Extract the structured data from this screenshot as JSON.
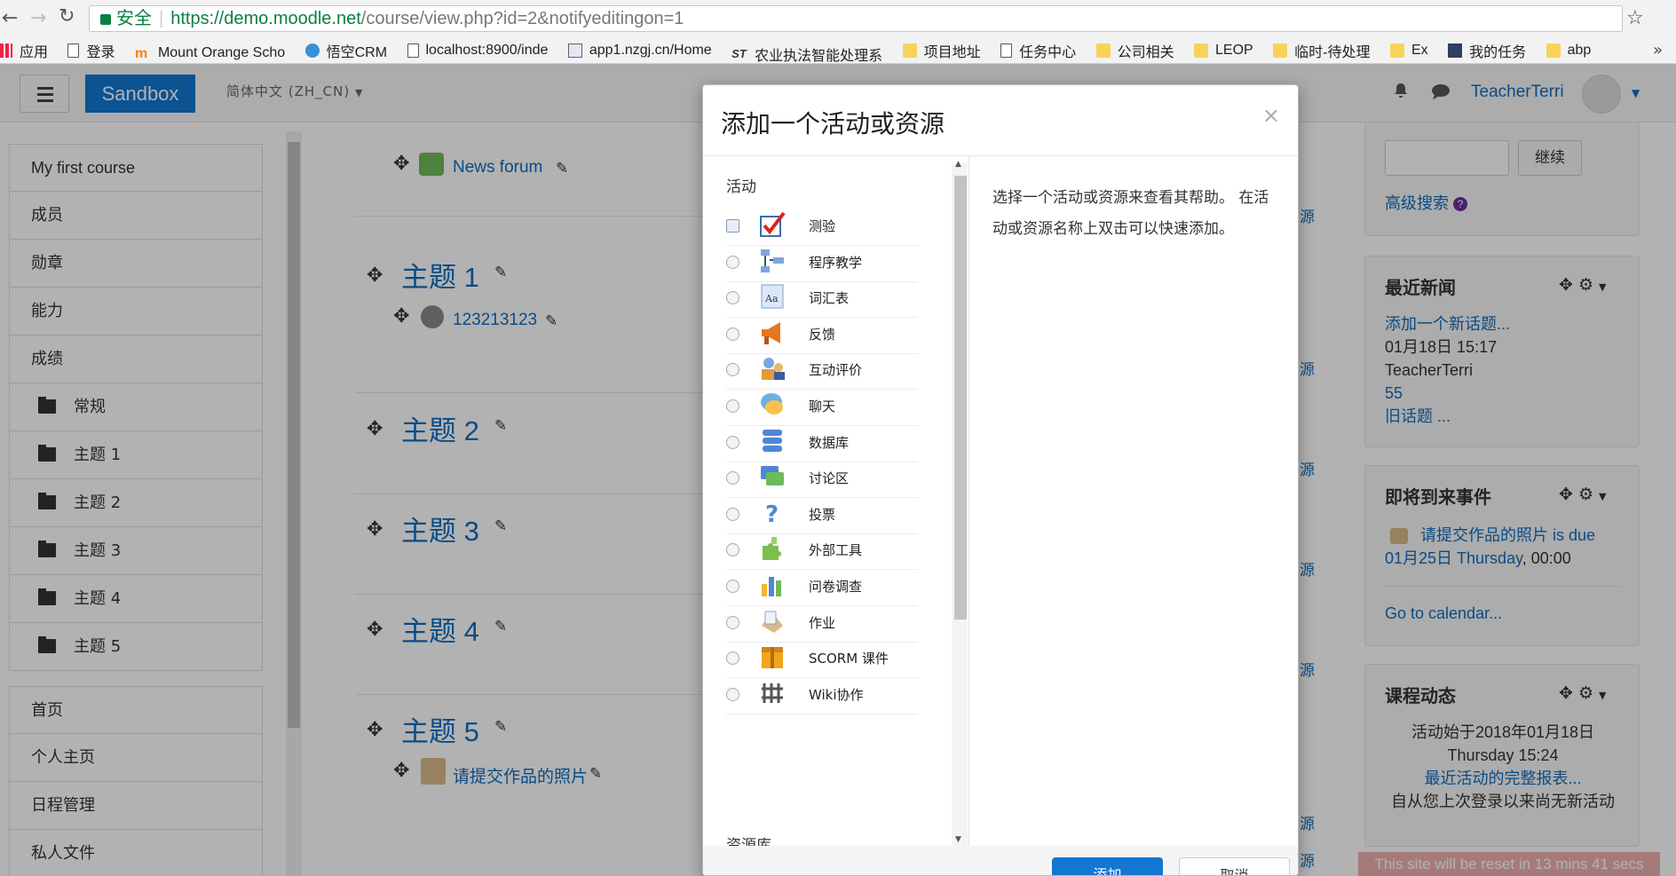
{
  "browser": {
    "secure_label": "安全",
    "url_host": "https://demo.moodle.net",
    "url_path": "/course/view.php?id=2&notifyeditingon=1",
    "bookmarks": [
      "应用",
      "登录",
      "Mount Orange Scho",
      "悟空CRM",
      "localhost:8900/inde",
      "app1.nzgj.cn/Home",
      "农业执法智能处理系",
      "项目地址",
      "任务中心",
      "公司相关",
      "LEOP",
      "临时-待处理",
      "Ex",
      "我的任务",
      "abp"
    ]
  },
  "navbar": {
    "brand": "Sandbox",
    "language": "简体中文 (ZH_CN)",
    "user": "TeacherTerri"
  },
  "leftnav": {
    "course_title": "My first course",
    "items": [
      "成员",
      "勋章",
      "能力",
      "成绩"
    ],
    "sections": [
      "常规",
      "主题 1",
      "主题 2",
      "主题 3",
      "主题 4",
      "主题 5"
    ],
    "global": [
      "首页",
      "个人主页",
      "日程管理",
      "私人文件"
    ]
  },
  "course": {
    "news_forum": "News forum",
    "topics": [
      {
        "title": "主题 1",
        "activity": "123213123"
      },
      {
        "title": "主题 2"
      },
      {
        "title": "主题 3"
      },
      {
        "title": "主题 4"
      },
      {
        "title": "主题 5",
        "activity": "请提交作品的照片"
      }
    ],
    "edge_text": "源"
  },
  "right": {
    "search_button": "继续",
    "advanced_search": "高级搜索",
    "news": {
      "title": "最近新闻",
      "add_topic": "添加一个新话题...",
      "date": "01月18日 15:17",
      "author": "TeacherTerri",
      "post": "55",
      "older": "旧话题 ..."
    },
    "events": {
      "title": "即将到来事件",
      "event": "请提交作品的照片 is due",
      "when_link": "01月25日 Thursday",
      "when_time": ", 00:00",
      "calendar_link": "Go to calendar..."
    },
    "activity": {
      "title": "课程动态",
      "since": "活动始于2018年01月18日",
      "since_time": "Thursday 15:24",
      "full_report": "最近活动的完整报表...",
      "nothing": "自从您上次登录以来尚无新活动"
    }
  },
  "modal": {
    "title": "添加一个活动或资源",
    "section_activities": "活动",
    "section_resources": "资源库",
    "help_text": "选择一个活动或资源来查看其帮助。 在活动或资源名称上双击可以快速添加。",
    "activities": [
      {
        "label": "测验",
        "icon": "quiz-icon"
      },
      {
        "label": "程序教学",
        "icon": "lesson-icon"
      },
      {
        "label": "词汇表",
        "icon": "glossary-icon"
      },
      {
        "label": "反馈",
        "icon": "feedback-icon"
      },
      {
        "label": "互动评价",
        "icon": "workshop-icon"
      },
      {
        "label": "聊天",
        "icon": "chat-icon"
      },
      {
        "label": "数据库",
        "icon": "database-icon"
      },
      {
        "label": "讨论区",
        "icon": "forum-icon"
      },
      {
        "label": "投票",
        "icon": "choice-icon"
      },
      {
        "label": "外部工具",
        "icon": "external-tool-icon"
      },
      {
        "label": "问卷调查",
        "icon": "survey-icon"
      },
      {
        "label": "作业",
        "icon": "assignment-icon"
      },
      {
        "label": "SCORM 课件",
        "icon": "scorm-icon"
      },
      {
        "label": "Wiki协作",
        "icon": "wiki-icon"
      }
    ],
    "add_button": "添加",
    "cancel_button": "取消"
  },
  "reset_notice": "This site will be reset in 13 mins 41 secs"
}
